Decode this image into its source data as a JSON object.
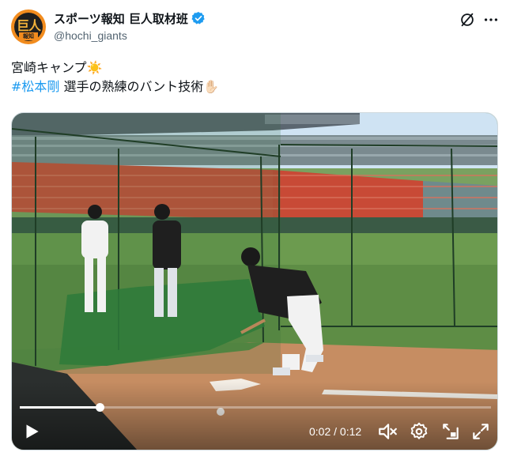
{
  "account": {
    "display_name": "スポーツ報知 巨人取材班",
    "handle": "@hochi_giants",
    "avatar_text": "巨人",
    "avatar_subtext": "報知",
    "verified": true,
    "verified_color": "#1d9bf0"
  },
  "tweet": {
    "line1_text": "宮崎キャンプ",
    "line1_emoji": "☀️",
    "hashtag": "#松本剛",
    "line2_text": " 選手の熟練のバント技術",
    "line2_emoji": "✋🏻"
  },
  "video": {
    "current_time": "0:02",
    "separator": " / ",
    "duration": "0:12",
    "progress": 0.17,
    "icons": [
      "play-icon",
      "volume-icon",
      "settings-icon",
      "pip-icon",
      "fullscreen-icon"
    ]
  },
  "header_icons": [
    "grok-icon",
    "more-icon"
  ],
  "colors": {
    "accent": "#1d9bf0",
    "text": "#0f1419",
    "secondary": "#536471"
  }
}
